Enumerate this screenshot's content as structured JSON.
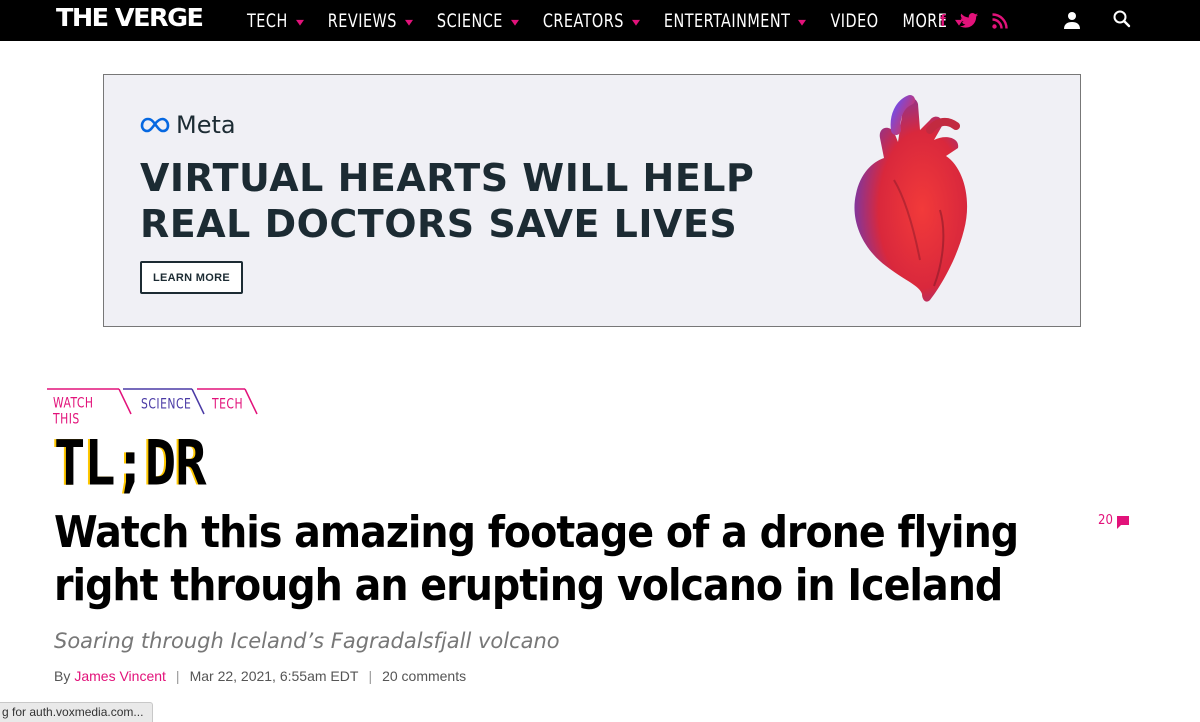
{
  "nav": {
    "logo": "THE VERGE",
    "items": [
      {
        "label": "TECH",
        "caret": true
      },
      {
        "label": "REVIEWS",
        "caret": true
      },
      {
        "label": "SCIENCE",
        "caret": true
      },
      {
        "label": "CREATORS",
        "caret": true
      },
      {
        "label": "ENTERTAINMENT",
        "caret": true
      },
      {
        "label": "VIDEO",
        "caret": false
      },
      {
        "label": "MORE",
        "caret": true
      }
    ],
    "social": {
      "facebook": "f",
      "twitter": "🐦",
      "rss": "rss-icon"
    },
    "accent": "#e2127a"
  },
  "ad": {
    "brand": "Meta",
    "headline_line1": "VIRTUAL HEARTS WILL HELP",
    "headline_line2": "REAL DOCTORS SAVE LIVES",
    "button": "LEARN MORE"
  },
  "tags": [
    {
      "label": "WATCH THIS",
      "color": "#e2127a"
    },
    {
      "label": "SCIENCE",
      "color": "#4a3aa5"
    },
    {
      "label": "TECH",
      "color": "#e2127a"
    }
  ],
  "article": {
    "kicker": "TL;DR",
    "headline": "Watch this amazing footage of a drone flying right through an erupting volcano in Iceland",
    "dek": "Soaring through Iceland’s Fagradalsfjall volcano",
    "by": "By",
    "author": "James Vincent",
    "date": "Mar 22, 2021, 6:55am EDT",
    "comments": "20 comments",
    "comment_count": "20"
  },
  "status_bar": "g for auth.voxmedia.com..."
}
